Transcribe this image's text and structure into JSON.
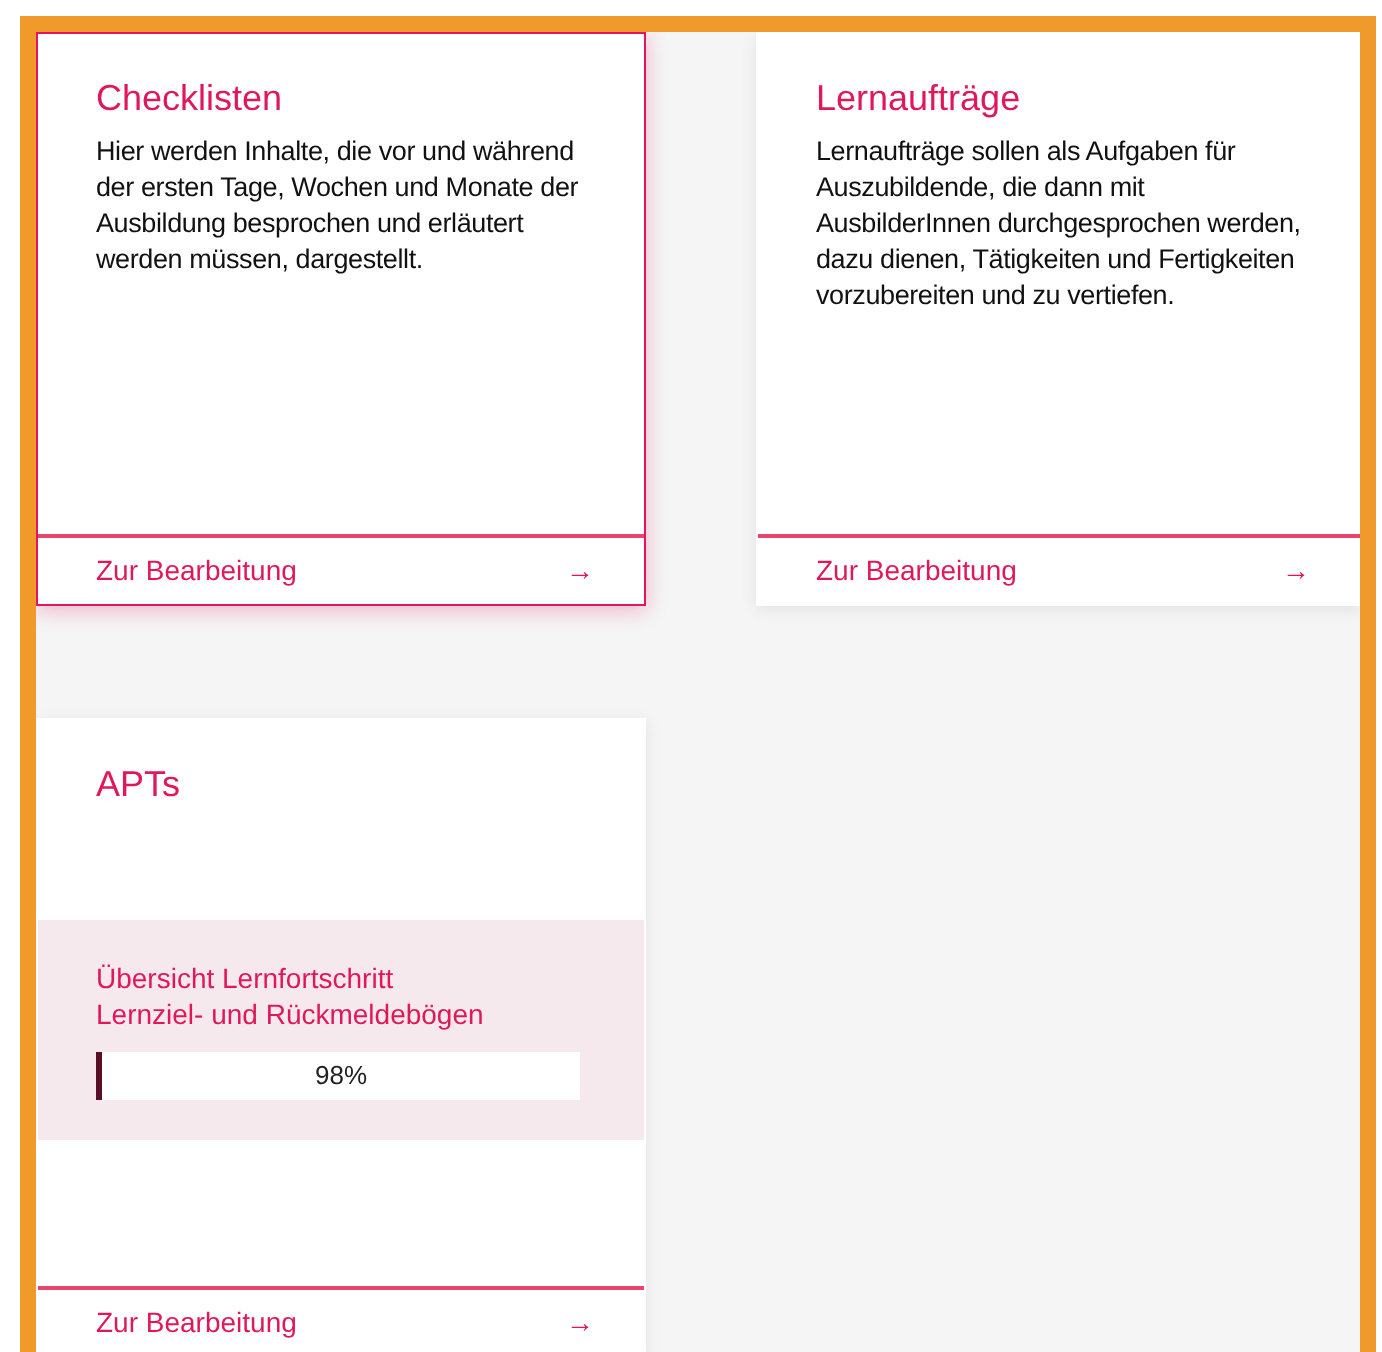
{
  "cards": [
    {
      "title": "Checklisten",
      "description": "Hier werden Inhalte, die vor und während der ersten Tage, Wochen und Monate der Ausbildung besprochen und erläutert werden müssen, dargestellt.",
      "highlighted": true,
      "footer_link": "Zur Bearbeitung",
      "footer_arrow": "→"
    },
    {
      "title": "Lernaufträge",
      "description": "Lernaufträge sollen als Aufgaben für Auszubildende, die dann mit AusbilderInnen durchgesprochen werden, dazu dienen, Tätigkeiten und Fertigkeiten vorzubereiten und zu vertiefen.",
      "highlighted": false,
      "footer_link": "Zur Bearbeitung",
      "footer_arrow": "→"
    },
    {
      "title": "APTs",
      "highlighted": false,
      "progress": {
        "lines": [
          "Übersicht Lernfortschritt",
          "Lernziel- und Rückmeldebögen"
        ],
        "reading": "98%"
      },
      "footer_link": "Zur Bearbeitung",
      "footer_arrow": "→"
    }
  ]
}
